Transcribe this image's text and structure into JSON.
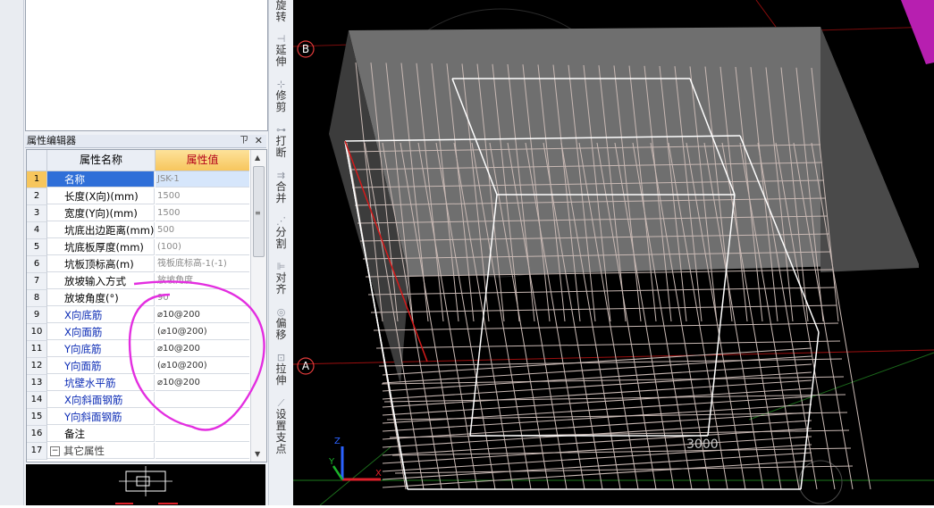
{
  "panel": {
    "title": "属性编辑器",
    "pin_label": "ㄗ",
    "close_label": "✕",
    "columns": {
      "name": "属性名称",
      "value": "属性值"
    },
    "rows": [
      {
        "num": "1",
        "name": "名称",
        "value": "JSK-1",
        "blue": false,
        "selected": true
      },
      {
        "num": "2",
        "name": "长度(X向)(mm)",
        "value": "1500",
        "blue": false
      },
      {
        "num": "3",
        "name": "宽度(Y向)(mm)",
        "value": "1500",
        "blue": false
      },
      {
        "num": "4",
        "name": "坑底出边距离(mm)",
        "value": "500",
        "blue": false
      },
      {
        "num": "5",
        "name": "坑底板厚度(mm)",
        "value": "(100)",
        "blue": false
      },
      {
        "num": "6",
        "name": "坑板顶标高(m)",
        "value": "筏板底标高-1(-1)",
        "blue": false
      },
      {
        "num": "7",
        "name": "放坡输入方式",
        "value": "放坡角度",
        "blue": false
      },
      {
        "num": "8",
        "name": "放坡角度(°)",
        "value": "90",
        "blue": false
      },
      {
        "num": "9",
        "name": "X向底筋",
        "value": "⌀10@200",
        "blue": true
      },
      {
        "num": "10",
        "name": "X向面筋",
        "value": "(⌀10@200)",
        "blue": true
      },
      {
        "num": "11",
        "name": "Y向底筋",
        "value": "⌀10@200",
        "blue": true
      },
      {
        "num": "12",
        "name": "Y向面筋",
        "value": "(⌀10@200)",
        "blue": true
      },
      {
        "num": "13",
        "name": "坑壁水平筋",
        "value": "⌀10@200",
        "blue": true
      },
      {
        "num": "14",
        "name": "X向斜面钢筋",
        "value": "",
        "blue": true
      },
      {
        "num": "15",
        "name": "Y向斜面钢筋",
        "value": "",
        "blue": true
      },
      {
        "num": "16",
        "name": "备注",
        "value": "",
        "blue": false
      },
      {
        "num": "17",
        "name": "其它属性",
        "value": "",
        "blue": false,
        "group": true
      }
    ]
  },
  "toolbar": [
    {
      "icon": "rotate-icon",
      "label": "旋转",
      "glyph": "↻"
    },
    {
      "icon": "extend-icon",
      "label": "延伸",
      "glyph": "⊣"
    },
    {
      "icon": "trim-icon",
      "label": "修剪",
      "glyph": "⊹"
    },
    {
      "icon": "break-icon",
      "label": "打断",
      "glyph": "⊶"
    },
    {
      "icon": "merge-icon",
      "label": "合并",
      "glyph": "⇉"
    },
    {
      "icon": "split-icon",
      "label": "分割",
      "glyph": "⋰"
    },
    {
      "icon": "align-icon",
      "label": "对齐",
      "glyph": "⊫"
    },
    {
      "icon": "offset-icon",
      "label": "偏移",
      "glyph": "◎"
    },
    {
      "icon": "stretch-icon",
      "label": "拉伸",
      "glyph": "⊡"
    },
    {
      "icon": "set-support-icon",
      "label": "设置支点",
      "glyph": "⟋"
    }
  ],
  "viewport": {
    "axis_b": "B",
    "axis_a": "A",
    "dimension_text": "3000",
    "axis_x": "X",
    "axis_y": "Y",
    "axis_z": "Z"
  }
}
